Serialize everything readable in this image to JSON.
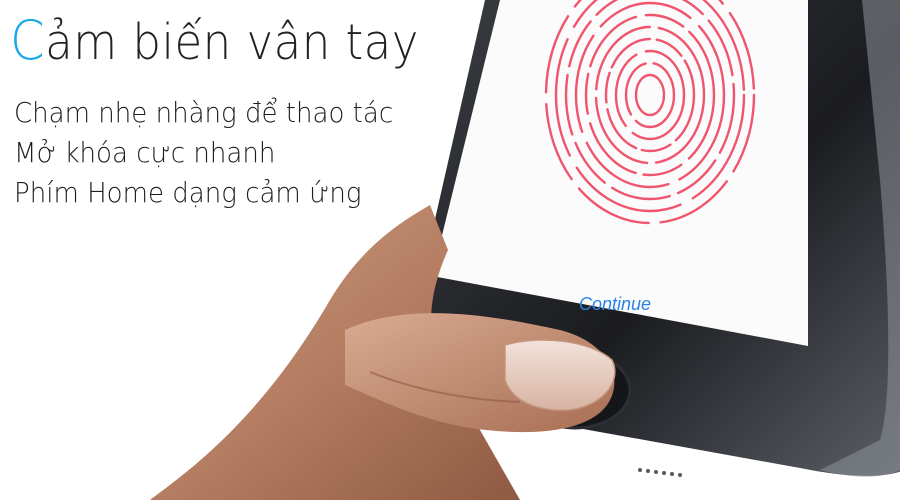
{
  "headline": {
    "first_letter": "C",
    "rest": "ảm biến vân tay"
  },
  "features": [
    "Chạm nhẹ nhàng để thao tác",
    "Mở khóa cực nhanh",
    "Phím Home dạng cảm ứng"
  ],
  "screen": {
    "continue_label": "Continue"
  },
  "colors": {
    "accent": "#1aa7e8",
    "fingerprint": "#f0556e",
    "link": "#2a84e4",
    "phone_body": "#202226"
  },
  "icons": [
    "fingerprint-icon",
    "home-button-icon"
  ]
}
